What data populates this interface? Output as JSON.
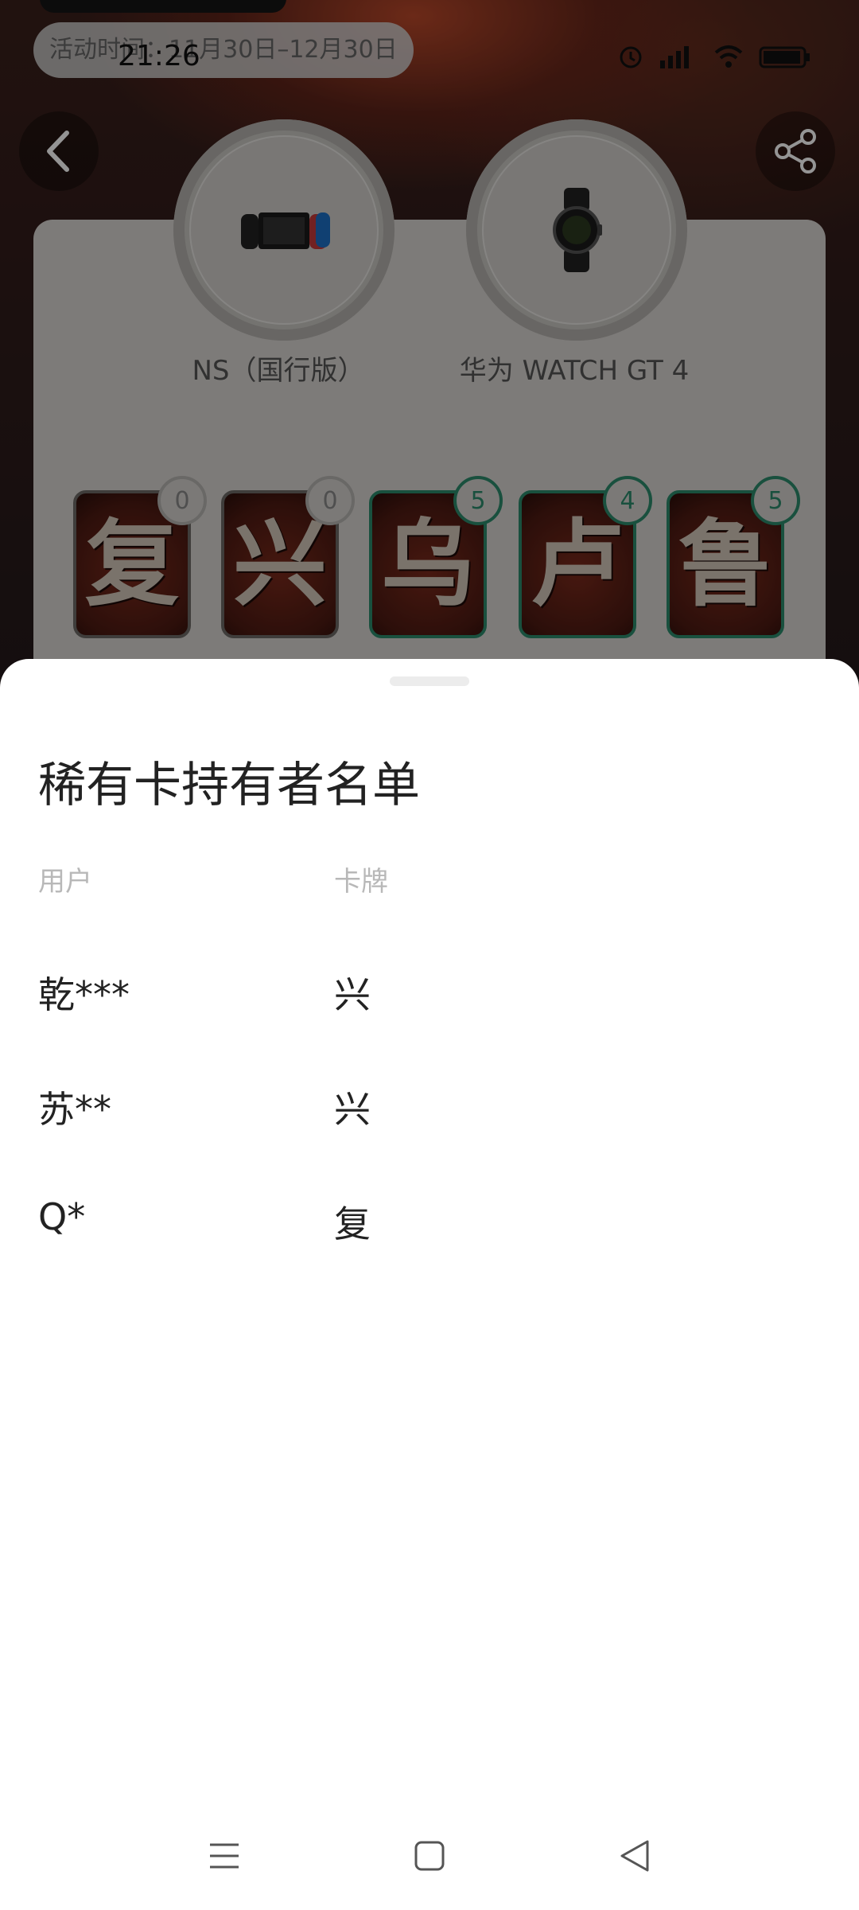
{
  "status_bar": {
    "time": "21:26"
  },
  "header": {
    "activity_period": "活动时间：11月30日–12月30日",
    "back_icon": "chevron-left-icon",
    "share_icon": "share-icon"
  },
  "prizes": [
    {
      "name": "NS（国行版）"
    },
    {
      "name": "华为 WATCH GT 4"
    }
  ],
  "cards": [
    {
      "char": "复",
      "count": "0",
      "owned": false
    },
    {
      "char": "兴",
      "count": "0",
      "owned": false
    },
    {
      "char": "乌",
      "count": "5",
      "owned": true
    },
    {
      "char": "卢",
      "count": "4",
      "owned": true
    },
    {
      "char": "鲁",
      "count": "5",
      "owned": true
    }
  ],
  "sheet": {
    "title": "稀有卡持有者名单",
    "columns": {
      "user": "用户",
      "card": "卡牌"
    },
    "rows": [
      {
        "user": "乾***",
        "card": "兴"
      },
      {
        "user": "苏**",
        "card": "兴"
      },
      {
        "user": "Q*",
        "card": "复"
      }
    ]
  },
  "navbar": {
    "menu_icon": "menu-icon",
    "home_icon": "home-square-icon",
    "back_icon": "back-triangle-icon"
  },
  "colors": {
    "accent_green": "#2c8a6b",
    "card_red": "#7a2a1c"
  }
}
